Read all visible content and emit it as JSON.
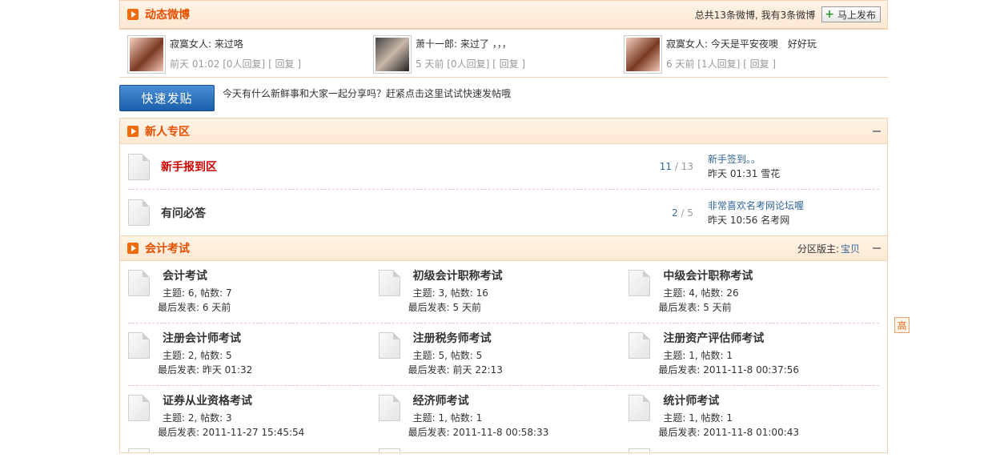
{
  "weibo": {
    "title": "动态微博",
    "summary": "总共13条微博, 我有3条微博",
    "publish_label": "马上发布",
    "items": [
      {
        "user": "寂寞女人",
        "text": "来过咯",
        "time": "前天 01:02",
        "replies": "[0人回复]",
        "reply_label": "[ 回复 ]"
      },
      {
        "user": "萧十一郎",
        "text": "来过了 ，，，",
        "time": "5 天前",
        "replies": "[0人回复]",
        "reply_label": "[ 回复 ]"
      },
      {
        "user": "寂寞女人",
        "text": "今天是平安夜噢　好好玩",
        "time": "6 天前",
        "replies": "[1人回复]",
        "reply_label": "[ 回复 ]"
      }
    ]
  },
  "quick_post": {
    "button_label": "快速发贴",
    "prompt": "今天有什么新鲜事和大家一起分享吗？赶紧点击这里试试快速发帖哦"
  },
  "newbie": {
    "title": "新人专区",
    "forums": [
      {
        "name": "新手报到区",
        "topics": "11",
        "posts": "13",
        "last_title": "新手签到。。",
        "last_time": "昨天 01:31",
        "last_user": "雪花"
      },
      {
        "name": "有问必答",
        "topics": "2",
        "posts": "5",
        "last_title": "非常喜欢名考网论坛喔",
        "last_time": "昨天 10:56",
        "last_user": "名考网"
      }
    ]
  },
  "accounting": {
    "title": "会计考试",
    "moderator_label": "分区版主:",
    "moderator": "宝贝",
    "forums": [
      {
        "name": "会计考试",
        "stats": "主题: 6, 帖数: 7",
        "last": "最后发表: 6 天前"
      },
      {
        "name": "初级会计职称考试",
        "stats": "主题: 3, 帖数: 16",
        "last": "最后发表: 5 天前"
      },
      {
        "name": "中级会计职称考试",
        "stats": "主题: 4, 帖数: 26",
        "last": "最后发表: 5 天前"
      },
      {
        "name": "注册会计师考试",
        "stats": "主题: 2, 帖数: 5",
        "last": "最后发表: 昨天 01:32"
      },
      {
        "name": "注册税务师考试",
        "stats": "主题: 5, 帖数: 5",
        "last": "最后发表: 前天 22:13"
      },
      {
        "name": "注册资产评估师考试",
        "stats": "主题: 1, 帖数: 1",
        "last": "最后发表: 2011-11-8 00:37:56"
      },
      {
        "name": "证券从业资格考试",
        "stats": "主题: 2, 帖数: 3",
        "last": "最后发表: 2011-11-27 15:45:54"
      },
      {
        "name": "经济师考试",
        "stats": "主题: 1, 帖数: 1",
        "last": "最后发表: 2011-11-8 00:58:33"
      },
      {
        "name": "统计师考试",
        "stats": "主题: 1, 帖数: 1",
        "last": "最后发表: 2011-11-8 01:00:43"
      }
    ]
  },
  "back_to_top": "高",
  "colors": {
    "accent": "#e64e00",
    "link": "#336699",
    "red_link": "#cc0000",
    "border": "#f3d2b3"
  }
}
